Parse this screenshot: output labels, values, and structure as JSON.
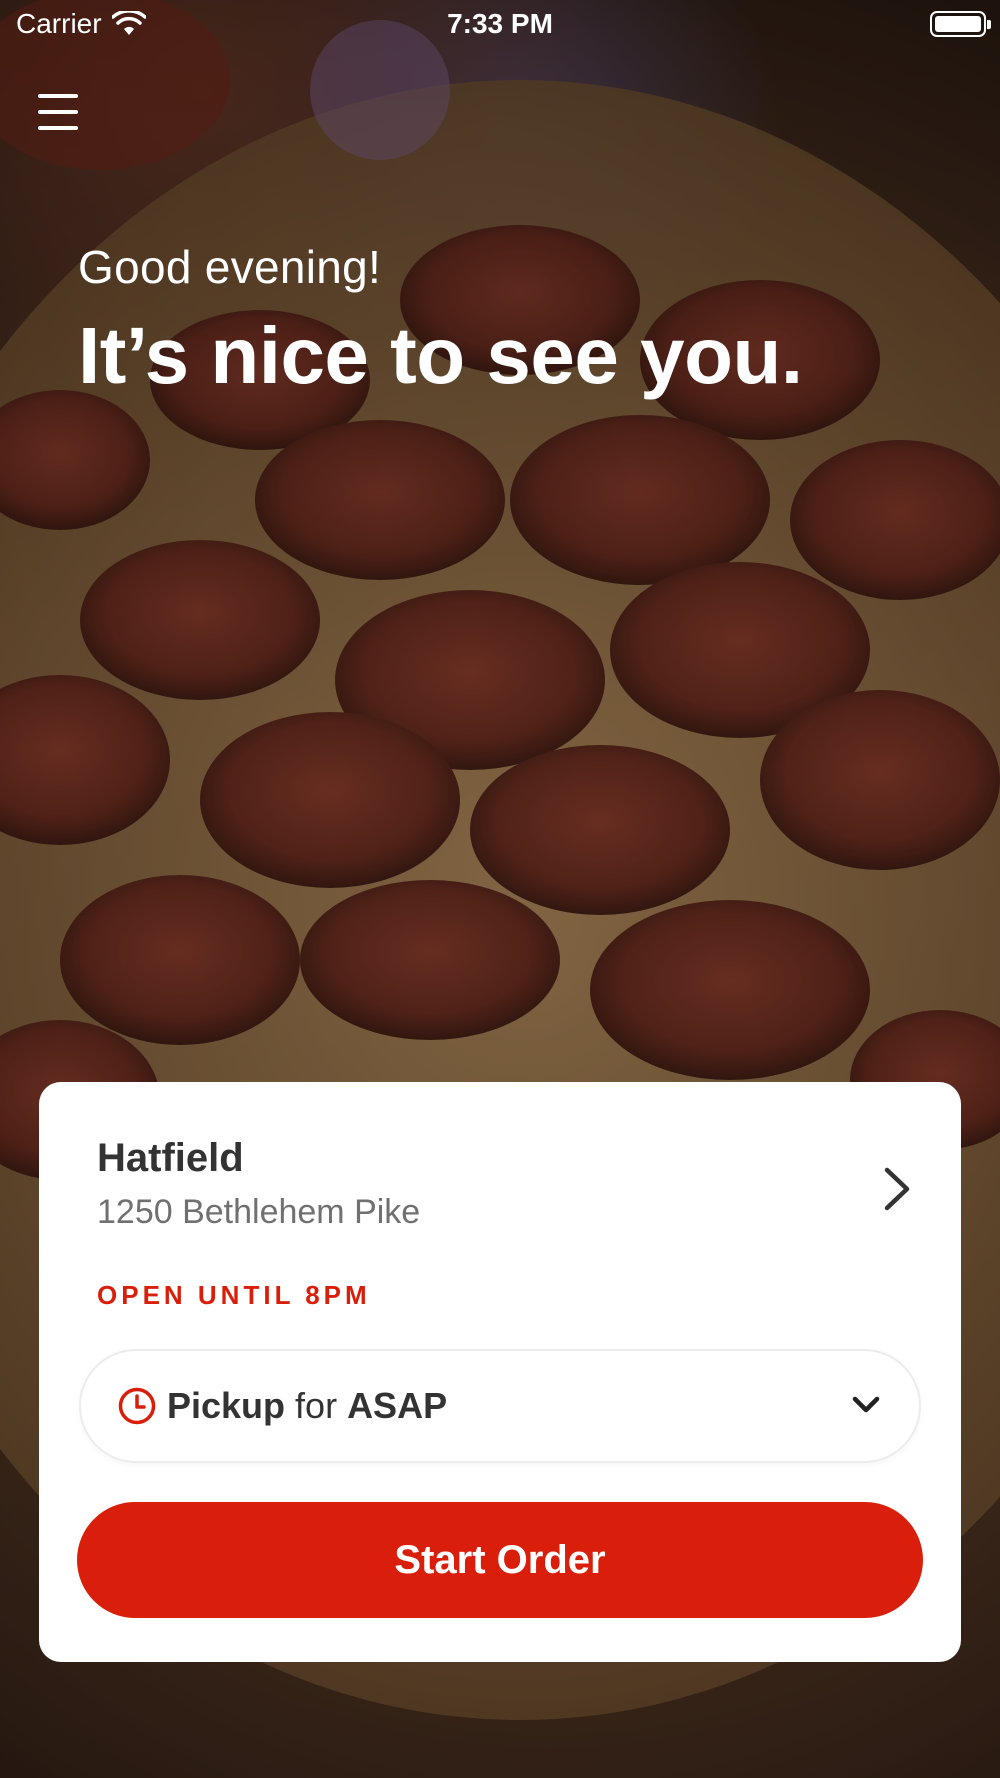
{
  "status_bar": {
    "carrier": "Carrier",
    "time": "7:33 PM",
    "icons": [
      "wifi-icon",
      "battery-icon"
    ]
  },
  "header": {
    "menu_icon": "menu-icon"
  },
  "greeting": {
    "small": "Good evening!",
    "large": "It’s nice to see you."
  },
  "location": {
    "name": "Hatfield",
    "address": "1250 Bethlehem Pike",
    "status": "OPEN UNTIL 8PM",
    "chevron_icon": "chevron-right-icon"
  },
  "order_type": {
    "icon": "clock-icon",
    "mode": "Pickup",
    "connector": "for",
    "time": "ASAP",
    "dropdown_icon": "chevron-down-icon"
  },
  "start_order": {
    "label": "Start Order"
  },
  "colors": {
    "accent": "#d91f0b",
    "text_dark": "#333333",
    "text_muted": "#707070",
    "card_bg": "#ffffff"
  }
}
